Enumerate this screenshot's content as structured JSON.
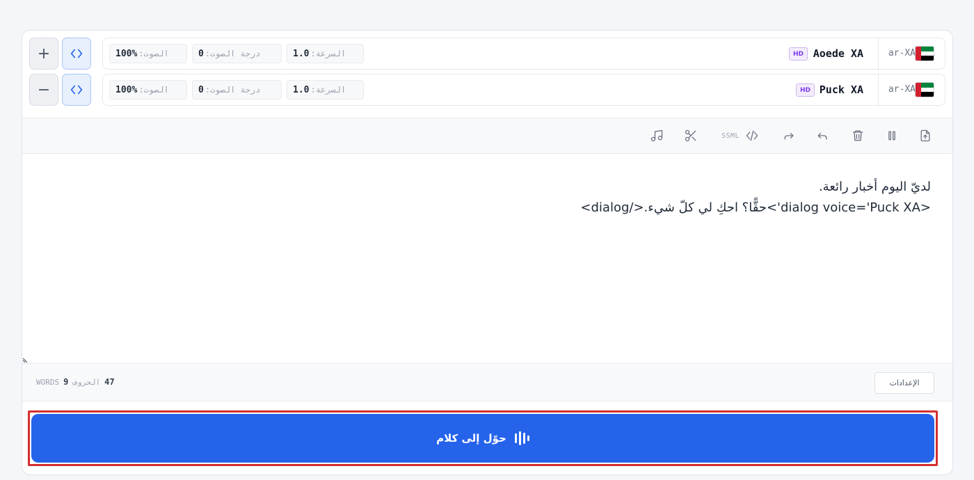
{
  "voices": [
    {
      "control_symbol": "+",
      "control_action": "add",
      "name": "Aoede XA",
      "badge": "HD",
      "lang": "ar-XA",
      "speed_label": "السرعة:",
      "speed_value": "1.0",
      "pitch_label": "درجة الصوت:",
      "pitch_value": "0",
      "volume_label": "الصوت:",
      "volume_value": "100%"
    },
    {
      "control_symbol": "−",
      "control_action": "remove",
      "name": "Puck XA",
      "badge": "HD",
      "lang": "ar-XA",
      "speed_label": "السرعة:",
      "speed_value": "1.0",
      "pitch_label": "درجة الصوت:",
      "pitch_value": "0",
      "volume_label": "الصوت:",
      "volume_value": "100%"
    }
  ],
  "toolbar": {
    "ssml_label": "SSML",
    "icons": [
      "upload-icon",
      "pause-icon",
      "trash-icon",
      "undo-icon",
      "redo-icon",
      "code-icon",
      "scissors-icon",
      "music-note-icon"
    ]
  },
  "editor": {
    "line1": "لديّ اليوم أخبار رائعة.",
    "line2": "<dialog voice='Puck XA'>حقًّا؟ احكِ لي كلّ شيء.</dialog>"
  },
  "footer": {
    "chars_count": "47",
    "chars_label": "الحروف",
    "words_count": "9",
    "words_label": "WORDS",
    "settings_label": "الإعدادات"
  },
  "convert": {
    "label": "حوّل إلى كلام",
    "icon": "audio-wave-icon"
  },
  "colors": {
    "accent": "#2563eb",
    "highlight_border": "#d32f2f",
    "hd_badge": "#7c3aed"
  }
}
